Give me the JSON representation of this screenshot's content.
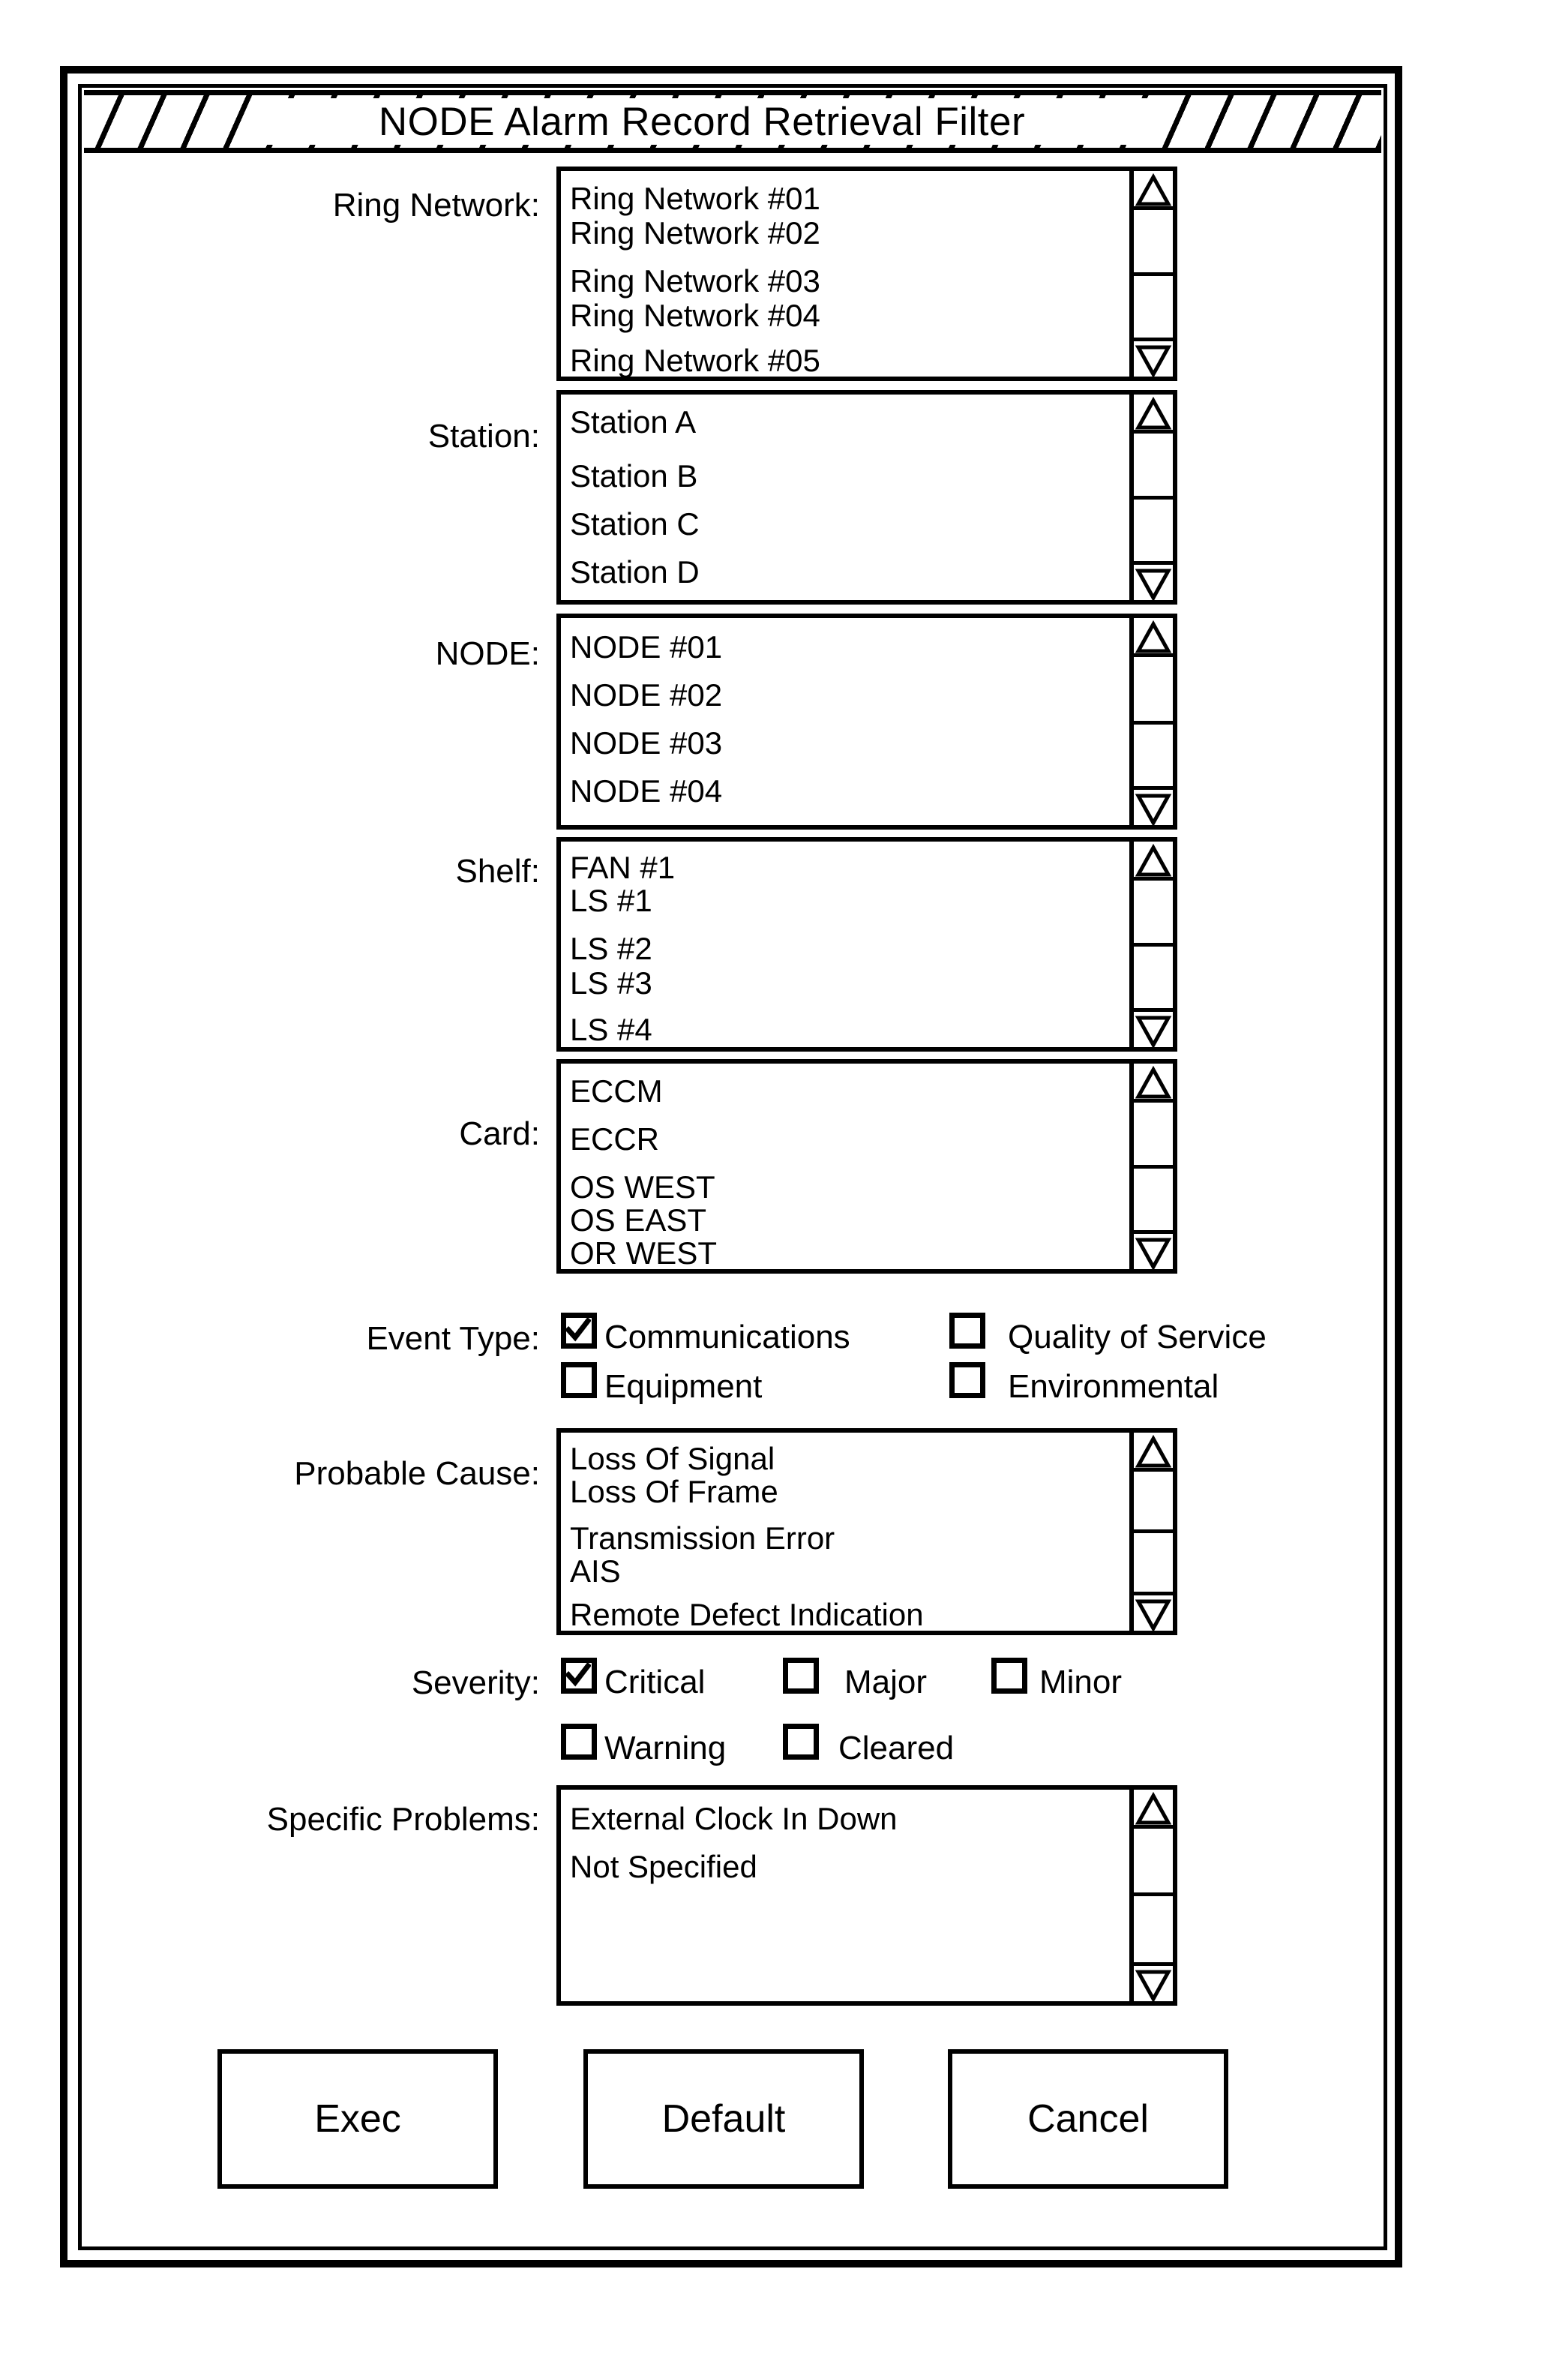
{
  "window": {
    "title": "NODE Alarm Record Retrieval Filter"
  },
  "fields": [
    {
      "key": "ring_network",
      "label": "Ring Network:",
      "items": [
        "Ring Network #01",
        "Ring Network #02",
        "Ring Network #03",
        "Ring Network #04",
        "Ring Network #05"
      ]
    },
    {
      "key": "station",
      "label": "Station:",
      "items": [
        "Station A",
        "Station B",
        "Station C",
        "Station D"
      ]
    },
    {
      "key": "node",
      "label": "NODE:",
      "items": [
        "NODE #01",
        "NODE #02",
        "NODE #03",
        "NODE #04"
      ]
    },
    {
      "key": "shelf",
      "label": "Shelf:",
      "items": [
        "FAN #1",
        "LS #1",
        "LS #2",
        "LS #3",
        "LS #4"
      ]
    },
    {
      "key": "card",
      "label": "Card:",
      "items": [
        "ECCM",
        "ECCR",
        "OS WEST",
        "OS EAST",
        "OR WEST"
      ]
    },
    {
      "key": "probable_cause",
      "label": "Probable Cause:",
      "items": [
        "Loss Of Signal",
        "Loss Of Frame",
        "Transmission Error",
        "AIS",
        "Remote Defect Indication"
      ]
    },
    {
      "key": "specific_problems",
      "label": "Specific Problems:",
      "items": [
        "External Clock In Down",
        "Not Specified"
      ]
    }
  ],
  "event_type": {
    "label": "Event Type:",
    "options": [
      {
        "label": "Communications",
        "checked": true
      },
      {
        "label": "Quality of Service",
        "checked": false
      },
      {
        "label": "Equipment",
        "checked": false
      },
      {
        "label": "Environmental",
        "checked": false
      }
    ]
  },
  "severity": {
    "label": "Severity:",
    "options": [
      {
        "label": "Critical",
        "checked": true
      },
      {
        "label": "Major",
        "checked": false
      },
      {
        "label": "Minor",
        "checked": false
      },
      {
        "label": "Warning",
        "checked": false
      },
      {
        "label": "Cleared",
        "checked": false
      }
    ]
  },
  "buttons": [
    {
      "key": "exec",
      "label": "Exec"
    },
    {
      "key": "default",
      "label": "Default"
    },
    {
      "key": "cancel",
      "label": "Cancel"
    }
  ],
  "colors": {
    "ink": "#000000",
    "paper": "#ffffff"
  }
}
